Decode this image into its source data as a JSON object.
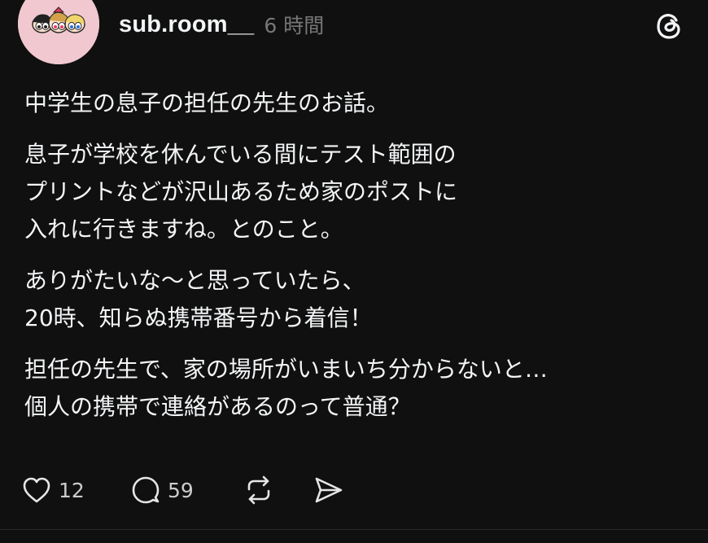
{
  "post": {
    "author": {
      "username": "sub.room__",
      "avatar_icon": "powerpuff-girls-avatar-icon"
    },
    "time": "6 時間",
    "app_icon": "threads-logo-icon",
    "paragraphs": [
      [
        "中学生の息子の担任の先生のお話。"
      ],
      [
        "息子が学校を休んでいる間にテスト範囲の",
        "プリントなどが沢山あるため家のポストに",
        "入れに行きますね。とのこと。"
      ],
      [
        "ありがたいな〜と思っていたら、",
        "20時、知らぬ携帯番号から着信！"
      ],
      [
        "担任の先生で、家の場所がいまいち分からないと…",
        "個人の携帯で連絡があるのって普通？"
      ]
    ],
    "actions": {
      "like_count": "12",
      "reply_count": "59"
    }
  },
  "colors": {
    "background": "#101010",
    "text": "#f3f5f7",
    "muted": "#777777",
    "avatar_bg": "#f1c8d0"
  }
}
